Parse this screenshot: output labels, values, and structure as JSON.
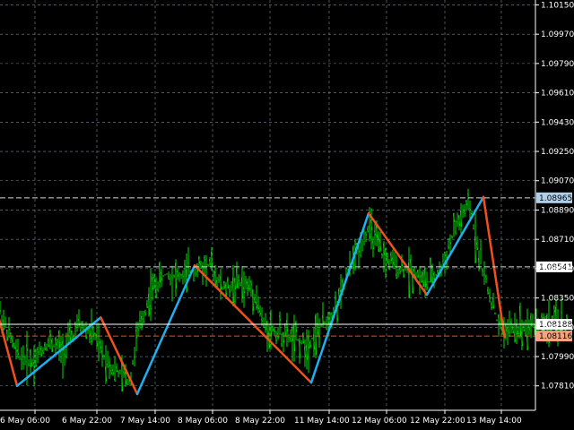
{
  "colors": {
    "background": "#000000",
    "grid": "#7a8a99",
    "axis": "#ffffff",
    "candle": "#00e000",
    "zigzag_up": "#1fb0f0",
    "zigzag_down": "#f0501e",
    "level_high": "#d9d9d9",
    "level_mid": "#d9d9d9",
    "level_bid": "#ffffff",
    "level_ask": "#f0501e",
    "tag_high_bg": "#b0d0ea",
    "tag_mid_bg": "#ffffff",
    "tag_bid_bg": "#ffffff",
    "tag_ask_bg": "#f6a47f"
  },
  "chart_data": {
    "type": "line",
    "title": "",
    "xlabel": "",
    "ylabel": "",
    "grid": true,
    "price_axis_position": "right",
    "ylim": [
      1.0766,
      1.1018
    ],
    "xlim": [
      "2024-05-06 00:00",
      "2024-05-14 17:00"
    ],
    "y_ticks": [
      "1.10150",
      "1.09970",
      "1.09790",
      "1.09610",
      "1.09430",
      "1.09250",
      "1.09070",
      "1.08890",
      "1.08710",
      "1.08530",
      "1.08350",
      "1.08170",
      "1.07990",
      "1.07810"
    ],
    "x_ticks": [
      "6 May 06:00",
      "6 May 22:00",
      "7 May 14:00",
      "8 May 06:00",
      "8 May 22:00",
      "11 May 14:00",
      "12 May 06:00",
      "12 May 22:00",
      "13 May 14:00"
    ],
    "zigzag": {
      "x": [
        "2024-05-06 00:00",
        "2024-05-06 06:00",
        "2024-05-07 04:00",
        "2024-05-07 14:00",
        "2024-05-08 06:00",
        "2024-05-11 14:00",
        "2024-05-12 06:00",
        "2024-05-12 22:00",
        "2024-05-13 14:00",
        "2024-05-13 20:00"
      ],
      "y": [
        1.0834,
        1.0781,
        1.0823,
        1.0776,
        1.0855,
        1.0783,
        1.0887,
        1.0837,
        1.0897,
        1.0811
      ]
    },
    "price_series": {
      "x": [
        "2024-05-06 00:00",
        "2024-05-06 04:00",
        "2024-05-06 06:00",
        "2024-05-06 10:00",
        "2024-05-06 14:00",
        "2024-05-06 18:00",
        "2024-05-06 22:00",
        "2024-05-07 02:00",
        "2024-05-07 04:00",
        "2024-05-07 08:00",
        "2024-05-07 12:00",
        "2024-05-07 14:00",
        "2024-05-07 18:00",
        "2024-05-07 22:00",
        "2024-05-08 02:00",
        "2024-05-08 06:00",
        "2024-05-08 10:00",
        "2024-05-08 14:00",
        "2024-05-08 18:00",
        "2024-05-08 22:00",
        "2024-05-09 02:00",
        "2024-05-09 06:00",
        "2024-05-09 10:00",
        "2024-05-11 10:00",
        "2024-05-11 14:00",
        "2024-05-11 18:00",
        "2024-05-11 22:00",
        "2024-05-12 02:00",
        "2024-05-12 06:00",
        "2024-05-12 10:00",
        "2024-05-12 14:00",
        "2024-05-12 18:00",
        "2024-05-12 22:00",
        "2024-05-13 02:00",
        "2024-05-13 06:00",
        "2024-05-13 10:00",
        "2024-05-13 14:00",
        "2024-05-13 18:00",
        "2024-05-13 20:00",
        "2024-05-14 02:00",
        "2024-05-14 08:00",
        "2024-05-14 14:00"
      ],
      "y": [
        1.0836,
        1.0812,
        1.08,
        1.0796,
        1.0808,
        1.0803,
        1.0818,
        1.0813,
        1.0802,
        1.079,
        1.0784,
        1.0812,
        1.084,
        1.085,
        1.0848,
        1.0852,
        1.0856,
        1.084,
        1.0844,
        1.0841,
        1.0836,
        1.0828,
        1.0818,
        1.0806,
        1.081,
        1.082,
        1.0834,
        1.086,
        1.0878,
        1.086,
        1.0853,
        1.0852,
        1.0844,
        1.0852,
        1.0878,
        1.0892,
        1.085,
        1.082,
        1.0815,
        1.0818,
        1.0819,
        1.0819
      ]
    },
    "levels": [
      {
        "price": 1.08965,
        "label": "1.08965",
        "style": "dashed",
        "kind": "high"
      },
      {
        "price": 1.08541,
        "label": "1.08541",
        "style": "dashed",
        "kind": "mid"
      },
      {
        "price": 1.08188,
        "label": "1.08188",
        "style": "solid",
        "kind": "bid"
      },
      {
        "price": 1.08116,
        "label": "1.08116",
        "style": "dashed",
        "kind": "ask"
      }
    ]
  }
}
